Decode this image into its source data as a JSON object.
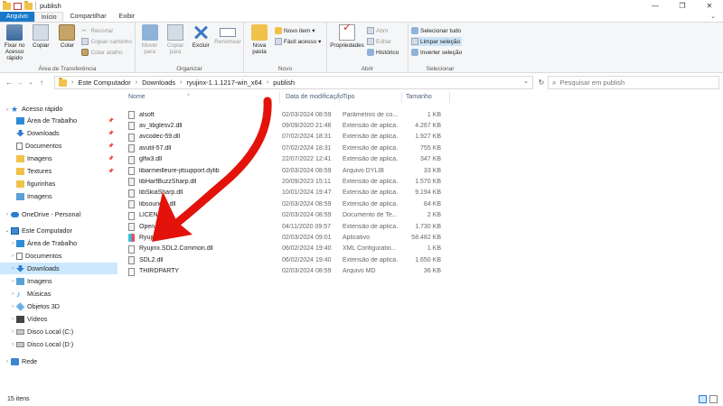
{
  "window": {
    "title": "publish",
    "minimize": "—",
    "maximize": "❐",
    "close": "✕"
  },
  "ribbon_tabs": [
    "Arquivo",
    "Início",
    "Compartilhar",
    "Exibir"
  ],
  "ribbon": {
    "clipboard": {
      "pin": "Fixar no Acesso rápido",
      "copy": "Copiar",
      "paste": "Colar",
      "cut": "Recortar",
      "copy_path": "Copiar caminho",
      "paste_shortcut": "Colar atalho",
      "label": "Área de Transferência"
    },
    "organize": {
      "move": "Mover para",
      "copy_to": "Copiar para",
      "delete": "Excluir",
      "rename": "Renomear",
      "label": "Organizar"
    },
    "new": {
      "new_folder": "Nova pasta",
      "new_item": "Novo item",
      "easy_access": "Fácil acesso",
      "label": "Novo"
    },
    "open": {
      "properties": "Propriedades",
      "open": "Abrir",
      "edit": "Editar",
      "history": "Histórico",
      "label": "Abrir"
    },
    "select": {
      "select_all": "Selecionar tudo",
      "clear": "Limpar seleção",
      "invert": "Inverter seleção",
      "label": "Selecionar"
    }
  },
  "address": {
    "path": [
      "Este Computador",
      "Downloads",
      "ryujinx-1.1.1217-win_x64",
      "publish"
    ],
    "search_placeholder": "Pesquisar em publish"
  },
  "nav": {
    "items": [
      {
        "label": "Acesso rápido",
        "icon": "star-icon",
        "level": 0,
        "expand": "⌄"
      },
      {
        "label": "Área de Trabalho",
        "icon": "desktop-icon",
        "level": 1,
        "pin": true
      },
      {
        "label": "Downloads",
        "icon": "download-icon",
        "level": 1,
        "pin": true
      },
      {
        "label": "Documentos",
        "icon": "document-icon",
        "level": 1,
        "pin": true
      },
      {
        "label": "Imagens",
        "icon": "folder-icon",
        "level": 1,
        "pin": true
      },
      {
        "label": "Textures",
        "icon": "folder-icon",
        "level": 1,
        "pin": true
      },
      {
        "label": "figurinhas",
        "icon": "folder-icon",
        "level": 1
      },
      {
        "label": "Imagens",
        "icon": "pictures-icon",
        "level": 1
      },
      {
        "label": "OneDrive - Personal",
        "icon": "cloud-icon",
        "level": 0,
        "expand": "›"
      },
      {
        "label": "Este Computador",
        "icon": "computer-icon",
        "level": 0,
        "expand": "⌄"
      },
      {
        "label": "Área de Trabalho",
        "icon": "desktop-icon",
        "level": 1,
        "expand": "›"
      },
      {
        "label": "Documentos",
        "icon": "document-icon",
        "level": 1,
        "expand": "›"
      },
      {
        "label": "Downloads",
        "icon": "download-icon",
        "level": 1,
        "expand": "›",
        "selected": true
      },
      {
        "label": "Imagens",
        "icon": "pictures-icon",
        "level": 1,
        "expand": "›"
      },
      {
        "label": "Músicas",
        "icon": "music-icon",
        "level": 1,
        "expand": "›"
      },
      {
        "label": "Objetos 3D",
        "icon": "objects3d-icon",
        "level": 1,
        "expand": "›"
      },
      {
        "label": "Vídeos",
        "icon": "video-icon",
        "level": 1,
        "expand": "›"
      },
      {
        "label": "Disco Local (C:)",
        "icon": "disk-icon",
        "level": 1,
        "expand": "›"
      },
      {
        "label": "Disco Local (D:)",
        "icon": "disk-icon",
        "level": 1,
        "expand": "›"
      },
      {
        "label": "Rede",
        "icon": "network-icon",
        "level": 0,
        "expand": "›"
      }
    ]
  },
  "columns": {
    "name": "Nome",
    "date": "Data de modificação",
    "type": "Tipo",
    "size": "Tamanho"
  },
  "files": [
    {
      "name": "alsoft",
      "date": "02/03/2024 08:59",
      "type": "Parâmetros de co...",
      "size": "1 KB",
      "icon": "cfg"
    },
    {
      "name": "av_libglesv2.dll",
      "date": "09/09/2020 21:46",
      "type": "Extensão de aplica...",
      "size": "4.267 KB",
      "icon": "dll"
    },
    {
      "name": "avcodec-59.dll",
      "date": "07/02/2024 18:31",
      "type": "Extensão de aplica...",
      "size": "1.927 KB",
      "icon": "dll"
    },
    {
      "name": "avutil-57.dll",
      "date": "07/02/2024 18:31",
      "type": "Extensão de aplica...",
      "size": "755 KB",
      "icon": "dll"
    },
    {
      "name": "glfw3.dll",
      "date": "22/07/2022 12:41",
      "type": "Extensão de aplica...",
      "size": "347 KB",
      "icon": "dll"
    },
    {
      "name": "libarmeilleure-jitsupport.dylib",
      "date": "02/03/2024 08:59",
      "type": "Arquivo DYLIB",
      "size": "33 KB",
      "icon": "doc"
    },
    {
      "name": "libHarfBuzzSharp.dll",
      "date": "20/09/2023 15:11",
      "type": "Extensão de aplica...",
      "size": "1.570 KB",
      "icon": "dll"
    },
    {
      "name": "libSkiaSharp.dll",
      "date": "10/01/2024 19:47",
      "type": "Extensão de aplica...",
      "size": "9.194 KB",
      "icon": "dll"
    },
    {
      "name": "libsoundio.dll",
      "date": "02/03/2024 08:59",
      "type": "Extensão de aplica...",
      "size": "84 KB",
      "icon": "dll"
    },
    {
      "name": "LICENSE",
      "date": "02/03/2024 08:59",
      "type": "Documento de Te...",
      "size": "2 KB",
      "icon": "doc"
    },
    {
      "name": "OpenAL32.dll",
      "date": "04/11/2020 09:57",
      "type": "Extensão de aplica...",
      "size": "1.730 KB",
      "icon": "dll"
    },
    {
      "name": "Ryujinx",
      "date": "02/03/2024 09:01",
      "type": "Aplicativo",
      "size": "58.482 KB",
      "icon": "app"
    },
    {
      "name": "Ryujinx.SDL2.Common.dll",
      "date": "06/02/2024 19:40",
      "type": "XML Configuratio...",
      "size": "1 KB",
      "icon": "cfg"
    },
    {
      "name": "SDL2.dll",
      "date": "06/02/2024 19:40",
      "type": "Extensão de aplica...",
      "size": "1.650 KB",
      "icon": "dll"
    },
    {
      "name": "THIRDPARTY",
      "date": "02/03/2024 08:59",
      "type": "Arquivo MD",
      "size": "36 KB",
      "icon": "doc"
    }
  ],
  "status": {
    "count": "15 itens"
  },
  "colors": {
    "accent": "#1979ca",
    "selection": "#cce8ff",
    "arrow": "#e3120b"
  }
}
